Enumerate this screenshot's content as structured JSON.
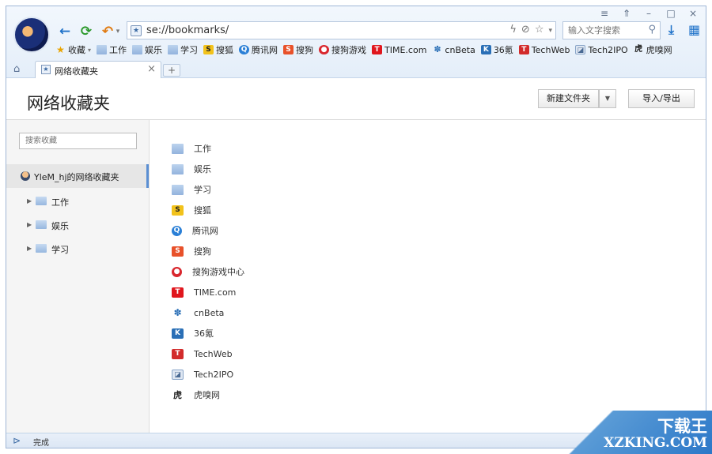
{
  "window": {
    "controls": [
      "≡",
      "⇑",
      "–",
      "□",
      "×"
    ]
  },
  "toolbar": {
    "address": "se://bookmarks/",
    "search_placeholder": "输入文字搜索"
  },
  "bookmarks_bar": {
    "items": [
      {
        "label": "收藏",
        "icon": "star-icon",
        "dropdown": "▾"
      },
      {
        "label": "工作",
        "icon": "folder-icon"
      },
      {
        "label": "娱乐",
        "icon": "folder-icon"
      },
      {
        "label": "学习",
        "icon": "folder-icon"
      },
      {
        "label": "搜狐",
        "icon": "sohu-icon",
        "color": "#f2c21b"
      },
      {
        "label": "腾讯网",
        "icon": "qq-icon",
        "color": "#2a7fd6"
      },
      {
        "label": "搜狗",
        "icon": "sogou-icon",
        "color": "#e8512a"
      },
      {
        "label": "搜狗游戏",
        "icon": "sogou-game-icon",
        "color": "#d9272e"
      },
      {
        "label": "TIME.com",
        "icon": "time-icon",
        "color": "#e0161d"
      },
      {
        "label": "cnBeta",
        "icon": "cnbeta-icon",
        "color": "#2a6fb6"
      },
      {
        "label": "36氪",
        "icon": "36kr-icon",
        "color": "#2a6fb6"
      },
      {
        "label": "TechWeb",
        "icon": "techweb-icon",
        "color": "#d22b2b"
      },
      {
        "label": "Tech2IPO",
        "icon": "tech2ipo-icon",
        "color": "#8aa6c9"
      },
      {
        "label": "虎嗅网",
        "icon": "huxiu-icon",
        "color": "#222222"
      }
    ]
  },
  "tabs": [
    {
      "title": "网络收藏夹"
    }
  ],
  "page": {
    "title": "网络收藏夹",
    "new_folder_label": "新建文件夹",
    "import_export_label": "导入/导出"
  },
  "sidebar": {
    "search_placeholder": "搜索收藏",
    "root_label": "YleM_hj的网络收藏夹",
    "folders": [
      {
        "label": "工作"
      },
      {
        "label": "娱乐"
      },
      {
        "label": "学习"
      }
    ]
  },
  "bookmark_list": [
    {
      "label": "工作",
      "icon": "folder-icon",
      "glyph": ""
    },
    {
      "label": "娱乐",
      "icon": "folder-icon",
      "glyph": ""
    },
    {
      "label": "学习",
      "icon": "folder-icon",
      "glyph": ""
    },
    {
      "label": "搜狐",
      "icon": "sohu-icon",
      "color": "#f2c21b",
      "glyph": "S"
    },
    {
      "label": "腾讯网",
      "icon": "qq-icon",
      "color": "#2a7fd6",
      "glyph": "Q"
    },
    {
      "label": "搜狗",
      "icon": "sogou-icon",
      "color": "#e8512a",
      "glyph": "S"
    },
    {
      "label": "搜狗游戏中心",
      "icon": "sogou-game-icon",
      "color": "#d9272e",
      "glyph": "●"
    },
    {
      "label": "TIME.com",
      "icon": "time-icon",
      "color": "#e0161d",
      "glyph": "T"
    },
    {
      "label": "cnBeta",
      "icon": "cnbeta-icon",
      "color": "#2a6fb6",
      "glyph": "✽"
    },
    {
      "label": "36氪",
      "icon": "36kr-icon",
      "color": "#2a6fb6",
      "glyph": "K"
    },
    {
      "label": "TechWeb",
      "icon": "techweb-icon",
      "color": "#d22b2b",
      "glyph": "T"
    },
    {
      "label": "Tech2IPO",
      "icon": "tech2ipo-icon",
      "color": "#8aa6c9",
      "glyph": "◪"
    },
    {
      "label": "虎嗅网",
      "icon": "huxiu-icon",
      "color": "#222222",
      "glyph": "虎"
    }
  ],
  "status": {
    "text": "完成"
  },
  "watermark": {
    "cn": "下载王",
    "en": "XZKING.COM"
  }
}
